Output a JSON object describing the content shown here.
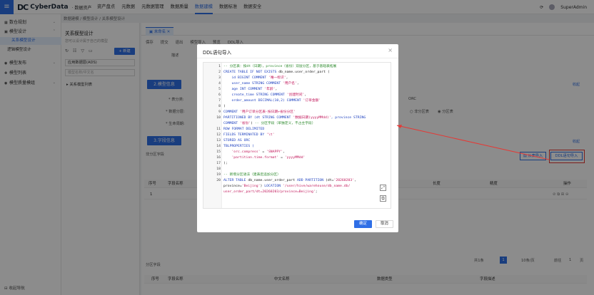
{
  "header": {
    "menu_icon": "menu-icon",
    "brand": "CyberData",
    "brand_sub": "· 数据资产",
    "nav": [
      "资产盘点",
      "元数据",
      "元数据管理",
      "数据质量",
      "数据建模",
      "数据标准",
      "数据安全"
    ],
    "active_nav": "数据建模",
    "user": "SuperAdmin"
  },
  "sidebar": {
    "items": [
      {
        "label": "数仓规划",
        "icon": "layers-icon"
      },
      {
        "label": "模型设计",
        "icon": "model-icon"
      },
      {
        "label": "关系模型设计",
        "sub": true
      },
      {
        "label": "逻辑模型设计",
        "sub": true
      },
      {
        "label": "模型发布",
        "icon": "publish-icon"
      },
      {
        "label": "模型列表",
        "icon": "list-icon"
      },
      {
        "label": "模型质量模组",
        "icon": "quality-icon"
      }
    ],
    "bottom": "收起导航"
  },
  "breadcrumb": "数据建模 / 模型设计 / 关系模型设计",
  "left_panel": {
    "title": "关系模型设计",
    "desc": "您可以设计属于自己的模型",
    "add_label": "+ 新建",
    "select_value": "应用数据层(ADS)",
    "search_placeholder": "模型名称/中文名",
    "tree_root": "关系模型列表"
  },
  "main": {
    "tab": "未命名",
    "toolbar": [
      "保存",
      "提交",
      "退出",
      "模型导入",
      "预览",
      "DDL导入"
    ],
    "section2": "2.模型信息",
    "section3": "3.字段信息",
    "expand": "收起",
    "labels": {
      "desc": "描述",
      "table_type": "* 表分类:",
      "data_layer": "* 数据分层:",
      "lifecycle": "* 生命周期:",
      "storage": "存储格式:",
      "partition_field": "分区字段"
    },
    "storage_value": "ORC",
    "radio_a": "非分区表",
    "radio_b": "分区表",
    "nonpartition_field": "非分区字段",
    "search_placeholder": "字段名称/中文名",
    "btn_from_table": "从表导入",
    "btn_ddl": "DDL语句导入",
    "table_headers": [
      "序号",
      "字段名称",
      "长度",
      "精度",
      "操作"
    ],
    "row_index": "1",
    "partition_headers": [
      "序号",
      "字段名称",
      "中文名称",
      "数据类型",
      "字段描述"
    ],
    "pager_total": "共1条",
    "pager_page": "1",
    "pager_size": "10条/页",
    "pager_goto": "前往",
    "pager_goto_val": "1",
    "pager_unit": "页"
  },
  "modal": {
    "title": "DDL语句导入",
    "close_icon": "close-icon",
    "ok": "确定",
    "cancel": "取消",
    "lines": [
      {
        "n": "1",
        "segs": [
          [
            "c",
            "-- 分区表：按dt（日期），province（省份）双层分区，基于基础表拓展"
          ]
        ]
      },
      {
        "n": "2",
        "segs": [
          [
            "k",
            "CREATE TABLE IF NOT EXISTS "
          ],
          [
            "t",
            "db_name.user_order_part ("
          ]
        ]
      },
      {
        "n": "3",
        "segs": [
          [
            "k",
            "    id BIGINT COMMENT "
          ],
          [
            "s",
            "'唯一标识'"
          ],
          [
            "t",
            ","
          ]
        ]
      },
      {
        "n": "4",
        "segs": [
          [
            "k",
            "    user_name STRING COMMENT "
          ],
          [
            "s",
            "'用户名'"
          ],
          [
            "t",
            ","
          ]
        ]
      },
      {
        "n": "5",
        "segs": [
          [
            "k",
            "    age INT COMMENT "
          ],
          [
            "s",
            "'年龄'"
          ],
          [
            "t",
            ","
          ]
        ]
      },
      {
        "n": "6",
        "segs": [
          [
            "k",
            "    create_time STRING COMMENT "
          ],
          [
            "s",
            "'创建时间'"
          ],
          [
            "t",
            ","
          ]
        ]
      },
      {
        "n": "7",
        "segs": [
          [
            "k",
            "    order_amount DECIMAL(10,2) COMMENT "
          ],
          [
            "s",
            "'订单金额'"
          ]
        ]
      },
      {
        "n": "8",
        "segs": [
          [
            "t",
            ")"
          ]
        ]
      },
      {
        "n": "9",
        "segs": [
          [
            "k",
            "COMMENT "
          ],
          [
            "s",
            "'用户订单分区表-按日期+省份分区'"
          ]
        ]
      },
      {
        "n": "10",
        "segs": [
          [
            "k",
            "PARTITIONED BY (dt STRING COMMENT "
          ],
          [
            "s",
            "'数据日期(yyyyMMdd)'"
          ],
          [
            "k",
            ", province STRING"
          ]
        ]
      },
      {
        "n": "",
        "segs": [
          [
            "k",
            "COMMENT "
          ],
          [
            "s",
            "'省份'"
          ],
          [
            "t",
            ") "
          ],
          [
            "c",
            "-- 分区字段（单独定义，不占主字段）"
          ]
        ]
      },
      {
        "n": "11",
        "segs": [
          [
            "k",
            "ROW FORMAT DELIMITED"
          ]
        ]
      },
      {
        "n": "12",
        "segs": [
          [
            "k",
            "FIELDS TERMINATED BY "
          ],
          [
            "s",
            "'\\t'"
          ]
        ]
      },
      {
        "n": "13",
        "segs": [
          [
            "k",
            "STORED AS ORC"
          ]
        ]
      },
      {
        "n": "14",
        "segs": [
          [
            "k",
            "TBLPROPERTIES ("
          ]
        ]
      },
      {
        "n": "15",
        "segs": [
          [
            "s",
            "    'orc.compress'"
          ],
          [
            "t",
            " = "
          ],
          [
            "s",
            "'SNAPPY'"
          ],
          [
            "t",
            ","
          ]
        ]
      },
      {
        "n": "16",
        "segs": [
          [
            "s",
            "    'partition.time.format'"
          ],
          [
            "t",
            " = "
          ],
          [
            "s",
            "'yyyyMMdd'"
          ]
        ]
      },
      {
        "n": "17",
        "segs": [
          [
            "t",
            ");"
          ]
        ]
      },
      {
        "n": "18",
        "segs": [
          [
            "t",
            ""
          ]
        ]
      },
      {
        "n": "19",
        "segs": [
          [
            "c",
            "-- 新增分区语法（建表后追加分区）"
          ]
        ]
      },
      {
        "n": "20",
        "segs": [
          [
            "k",
            "ALTER TABLE "
          ],
          [
            "t",
            "db_name.user_order_part "
          ],
          [
            "k",
            "ADD PARTITION "
          ],
          [
            "t",
            "(dt="
          ],
          [
            "s",
            "'20260203'"
          ],
          [
            "t",
            ","
          ]
        ]
      },
      {
        "n": "",
        "segs": [
          [
            "t",
            "province="
          ],
          [
            "s",
            "'Beijing'"
          ],
          [
            "t",
            ") "
          ],
          [
            "k",
            "LOCATION "
          ],
          [
            "s",
            "'/user/hive/warehouse/db_name.db/"
          ]
        ]
      },
      {
        "n": "",
        "segs": [
          [
            "s",
            "user_order_part/dt=20260203/province=Beijing'"
          ],
          [
            "t",
            ";"
          ]
        ]
      }
    ]
  }
}
